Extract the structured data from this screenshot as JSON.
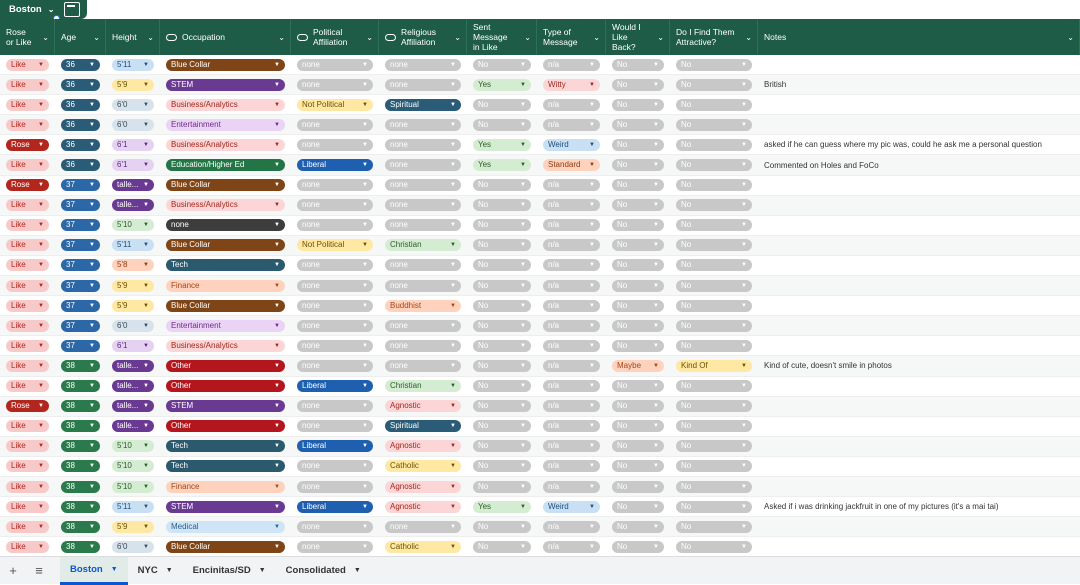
{
  "table_name": "Boston",
  "columns": [
    {
      "key": "rose",
      "label": "Rose or Like",
      "w": 55,
      "type": "chip"
    },
    {
      "key": "age",
      "label": "Age",
      "w": 51,
      "type": "chip"
    },
    {
      "key": "height",
      "label": "Height",
      "w": 54,
      "type": "chip"
    },
    {
      "key": "occupation",
      "label": "Occupation",
      "w": 131,
      "type": "chip",
      "icon": true
    },
    {
      "key": "political",
      "label": "Political Affiliation",
      "w": 88,
      "type": "chip",
      "icon": true
    },
    {
      "key": "religious",
      "label": "Religious Affiliation",
      "w": 88,
      "type": "chip",
      "icon": true
    },
    {
      "key": "sent",
      "label": "Sent Message in Like",
      "w": 70,
      "type": "chip"
    },
    {
      "key": "msgtype",
      "label": "Type of Message",
      "w": 69,
      "type": "chip"
    },
    {
      "key": "likeback",
      "label": "Would I Like Back?",
      "w": 64,
      "type": "chip"
    },
    {
      "key": "attractive",
      "label": "Do I Find Them Attractive?",
      "w": 88,
      "type": "chip"
    },
    {
      "key": "notes",
      "label": "Notes",
      "w": 322,
      "type": "text"
    }
  ],
  "colors": {
    "Like": "#f8c9c9|#b3261e",
    "Rose": "#b3261e|#ffffff",
    "36": "#2b5c77|#ffffff",
    "37": "#2c67a8|#ffffff",
    "38": "#2a7a4c|#ffffff",
    "5'11": "#c9dff4|#1f4e7a",
    "5'9": "#ffe8a3|#6b5200",
    "6'0": "#d7e3ec|#3a4a55",
    "6'1": "#e5d2f2|#5b2b7d",
    "5'10": "#d4ecd1|#2e5e2a",
    "5'8": "#ffd2bd|#8a3b12",
    "taller": "#6a3a93|#ffffff",
    "Blue Collar": "#7f4516|#ffffff",
    "STEM": "#6a3a93|#ffffff",
    "Business/Analytics": "#fcd6d6|#a1271e",
    "Entertainment": "#ead3f5|#6b2f87",
    "Education/Higher Ed": "#237545|#ffffff",
    "none-occ": "#3d3d3d|#ffffff",
    "Tech": "#2b5a6e|#ffffff",
    "Finance": "#ffd2bd|#a1471a",
    "Other": "#b3171d|#ffffff",
    "Medical": "#cfe5f7|#2a5f8f",
    "none": "#c8c8c8|#ffffff",
    "Not Political": "#ffe8a3|#6b5200",
    "Liberal": "#1f5fb0|#ffffff",
    "Spiritual": "#2b5c77|#ffffff",
    "Christian": "#d4ecd1|#2e5e2a",
    "Buddhist": "#ffd2bd|#a1471a",
    "Agnostic": "#fcd6d6|#a1271e",
    "Catholic": "#ffe8a3|#6b5200",
    "No": "#c8c8c8|#ffffff",
    "Yes": "#d4ecd1|#2e5e2a",
    "n/a": "#c8c8c8|#ffffff",
    "Witty": "#fcd6d6|#a1271e",
    "Weird": "#c9dff4|#1f4e7a",
    "Standard": "#ffd2bd|#8a3b12",
    "Maybe": "#ffd2bd|#a1471a",
    "Kind Of": "#ffe8a3|#6b5200"
  },
  "rows": [
    [
      "Like",
      "36",
      "5'11",
      "Blue Collar",
      "none",
      "none",
      "No",
      "n/a",
      "No",
      "No",
      ""
    ],
    [
      "Like",
      "36",
      "5'9",
      "STEM",
      "none",
      "none",
      "Yes",
      "Witty",
      "No",
      "No",
      "British"
    ],
    [
      "Like",
      "36",
      "6'0",
      "Business/Analytics",
      "Not Political",
      "Spiritual",
      "No",
      "n/a",
      "No",
      "No",
      ""
    ],
    [
      "Like",
      "36",
      "6'0",
      "Entertainment",
      "none",
      "none",
      "No",
      "n/a",
      "No",
      "No",
      ""
    ],
    [
      "Rose",
      "36",
      "6'1",
      "Business/Analytics",
      "none",
      "none",
      "Yes",
      "Weird",
      "No",
      "No",
      "asked if he can guess where my pic was, could he ask me a personal question"
    ],
    [
      "Like",
      "36",
      "6'1",
      "Education/Higher Ed",
      "Liberal",
      "none",
      "Yes",
      "Standard",
      "No",
      "No",
      "Commented on Holes and FoCo"
    ],
    [
      "Rose",
      "37",
      "talle...",
      "Blue Collar",
      "none",
      "none",
      "No",
      "n/a",
      "No",
      "No",
      ""
    ],
    [
      "Like",
      "37",
      "talle...",
      "Business/Analytics",
      "none",
      "none",
      "No",
      "n/a",
      "No",
      "No",
      ""
    ],
    [
      "Like",
      "37",
      "5'10",
      "none",
      "none",
      "none",
      "No",
      "n/a",
      "No",
      "No",
      ""
    ],
    [
      "Like",
      "37",
      "5'11",
      "Blue Collar",
      "Not Political",
      "Christian",
      "No",
      "n/a",
      "No",
      "No",
      ""
    ],
    [
      "Like",
      "37",
      "5'8",
      "Tech",
      "none",
      "none",
      "No",
      "n/a",
      "No",
      "No",
      ""
    ],
    [
      "Like",
      "37",
      "5'9",
      "Finance",
      "none",
      "none",
      "No",
      "n/a",
      "No",
      "No",
      ""
    ],
    [
      "Like",
      "37",
      "5'9",
      "Blue Collar",
      "none",
      "Buddhist",
      "No",
      "n/a",
      "No",
      "No",
      ""
    ],
    [
      "Like",
      "37",
      "6'0",
      "Entertainment",
      "none",
      "none",
      "No",
      "n/a",
      "No",
      "No",
      ""
    ],
    [
      "Like",
      "37",
      "6'1",
      "Business/Analytics",
      "none",
      "none",
      "No",
      "n/a",
      "No",
      "No",
      ""
    ],
    [
      "Like",
      "38",
      "talle...",
      "Other",
      "none",
      "none",
      "No",
      "n/a",
      "Maybe",
      "Kind Of",
      "Kind of cute, doesn't smile in photos"
    ],
    [
      "Like",
      "38",
      "talle...",
      "Other",
      "Liberal",
      "Christian",
      "No",
      "n/a",
      "No",
      "No",
      ""
    ],
    [
      "Rose",
      "38",
      "talle...",
      "STEM",
      "none",
      "Agnostic",
      "No",
      "n/a",
      "No",
      "No",
      ""
    ],
    [
      "Like",
      "38",
      "talle...",
      "Other",
      "none",
      "Spiritual",
      "No",
      "n/a",
      "No",
      "No",
      ""
    ],
    [
      "Like",
      "38",
      "5'10",
      "Tech",
      "Liberal",
      "Agnostic",
      "No",
      "n/a",
      "No",
      "No",
      ""
    ],
    [
      "Like",
      "38",
      "5'10",
      "Tech",
      "none",
      "Catholic",
      "No",
      "n/a",
      "No",
      "No",
      ""
    ],
    [
      "Like",
      "38",
      "5'10",
      "Finance",
      "none",
      "Agnostic",
      "No",
      "n/a",
      "No",
      "No",
      ""
    ],
    [
      "Like",
      "38",
      "5'11",
      "STEM",
      "Liberal",
      "Agnostic",
      "Yes",
      "Weird",
      "No",
      "No",
      "Asked if i was drinking jackfruit in one of my pictures (it's a mai tai)"
    ],
    [
      "Like",
      "38",
      "5'9",
      "Medical",
      "none",
      "none",
      "No",
      "n/a",
      "No",
      "No",
      ""
    ],
    [
      "Like",
      "38",
      "6'0",
      "Blue Collar",
      "none",
      "Catholic",
      "No",
      "n/a",
      "No",
      "No",
      ""
    ]
  ],
  "tabs": [
    {
      "label": "Boston",
      "active": true
    },
    {
      "label": "NYC",
      "active": false
    },
    {
      "label": "Encinitas/SD",
      "active": false
    },
    {
      "label": "Consolidated",
      "active": false
    }
  ],
  "icons": {
    "add": "plus-icon",
    "menu": "hamburger-icon",
    "table": "calculator-icon"
  }
}
